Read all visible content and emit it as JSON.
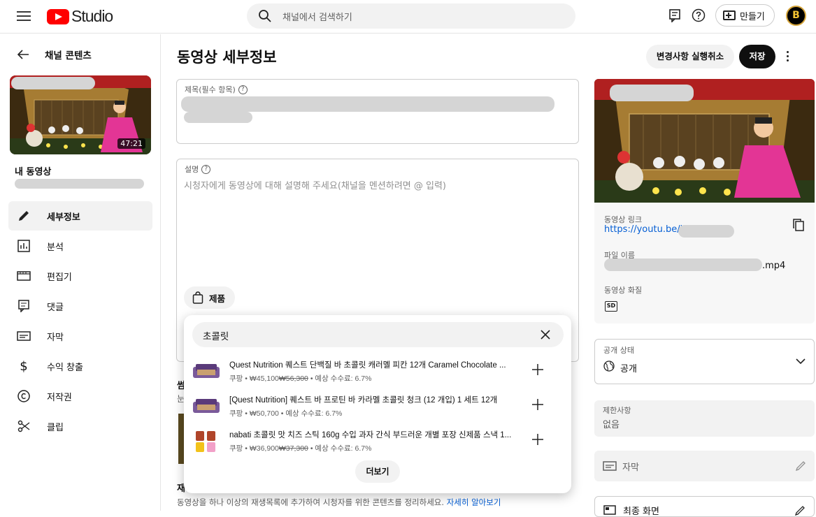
{
  "header": {
    "logo_text": "Studio",
    "search_placeholder": "채널에서 검색하기",
    "create_label": "만들기",
    "avatar_letter": "B"
  },
  "sidebar": {
    "back_label": "채널 콘텐츠",
    "duration": "47:21",
    "my_video_label": "내 동영상",
    "items": [
      {
        "label": "세부정보",
        "icon": "pencil-icon",
        "active": true
      },
      {
        "label": "분석",
        "icon": "analytics-icon"
      },
      {
        "label": "편집기",
        "icon": "editor-icon"
      },
      {
        "label": "댓글",
        "icon": "comments-icon"
      },
      {
        "label": "자막",
        "icon": "subtitles-icon"
      },
      {
        "label": "수익 창출",
        "icon": "dollar-icon"
      },
      {
        "label": "저작권",
        "icon": "copyright-icon"
      },
      {
        "label": "클립",
        "icon": "scissors-icon"
      }
    ]
  },
  "main": {
    "title": "동영상 세부정보",
    "undo_label": "변경사항 실행취소",
    "save_label": "저장",
    "title_field_label": "제목(필수 항목)",
    "description_label": "설명",
    "description_placeholder": "시청자에게 동영상에 대해 설명해 주세요(채널을 멘션하려면 @ 입력)",
    "product_chip_label": "제품",
    "thumbnail_section_partial": "썸",
    "thumbnail_desc_partial": "눈",
    "playlist_heading_partial": "재",
    "playlist_desc": "동영상을 하나 이상의 재생목록에 추가하여 시청자를 위한 콘텐츠를 정리하세요.",
    "learn_more": "자세히 알아보기"
  },
  "product_popup": {
    "query": "초콜릿",
    "more_label": "더보기",
    "products": [
      {
        "title": "Quest Nutrition 퀘스트 단백질 바 초콜릿 캐러멜 피칸 12개 Caramel Chocolate ...",
        "store": "쿠팡",
        "price": "₩45,100",
        "original_price": "₩56,300",
        "commission": "예상 수수료: 6.7%"
      },
      {
        "title": "[Quest Nutrition] 퀘스트 바 프로틴 바 카라멜 초콜릿 청크 (12 개입) 1 세트 12개",
        "store": "쿠팡",
        "price": "₩50,700",
        "original_price": "",
        "commission": "예상 수수료: 6.7%"
      },
      {
        "title": "nabati 초콜릿 맛 치즈 스틱 160g 수입 과자 간식 부드러운 개별 포장 신제품 스낵 1...",
        "store": "쿠팡",
        "price": "₩36,900",
        "original_price": "₩37,300",
        "commission": "예상 수수료: 6.7%"
      }
    ]
  },
  "right_panel": {
    "video_link_label": "동영상 링크",
    "video_link": "https://youtu.be/i",
    "file_name_label": "파일 이름",
    "file_ext": ".mp4",
    "quality_label": "동영상 화질",
    "quality_badge": "SD",
    "visibility_label": "공개 상태",
    "visibility_value": "공개",
    "restrictions_label": "제한사항",
    "restrictions_value": "없음",
    "subtitles_label": "자막",
    "end_screen_label": "최종 화면"
  },
  "colors": {
    "brand_red": "#ff0000",
    "link_blue": "#065fd4",
    "save_bg": "#0f0f0f"
  }
}
